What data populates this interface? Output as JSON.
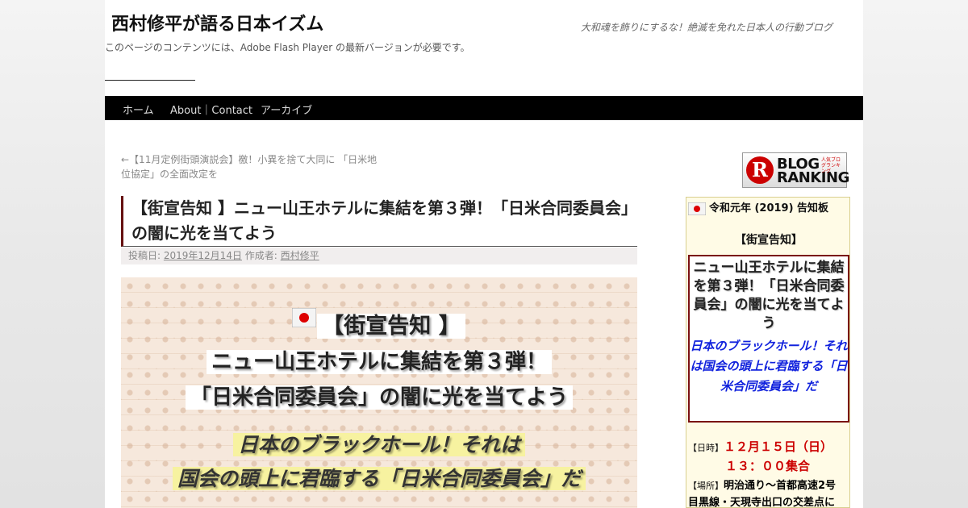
{
  "site": {
    "title": "西村修平が語る日本イズム",
    "tagline": "大和魂を飾りにするな！絶滅を免れた日本人の行動ブログ",
    "flash_notice": "このページのコンテンツには、Adobe Flash Player の最新バージョンが必要です。"
  },
  "nav": {
    "items": [
      "ホーム",
      "About｜Contact",
      "アーカイブ"
    ]
  },
  "prev_post": {
    "line1": "←【11月定例街頭演説会】檄！小異を捨て大同に 「日米地",
    "line2": "位協定」の全面改定を"
  },
  "post": {
    "title": "【街宣告知 】ニュー山王ホテルに集結を第３弾！「日米合同委員会」の闇に光を当てよう",
    "meta_posted_label": "投稿日:",
    "meta_date": "2019年12月14日",
    "meta_author_label": "作成者:",
    "meta_author": "西村修平"
  },
  "banner": {
    "line1": "【街宣告知 】",
    "line2": "ニュー山王ホテルに集結を第３弾！",
    "line3": "「日米合同委員会」の闇に光を当てよう",
    "line4": "日本のブラックホール！それは",
    "line5": "国会の頭上に君臨する「日米合同委員会」だ"
  },
  "ranking_badge": {
    "letter": "R",
    "line1": "BLOG",
    "line2": "RANKING",
    "small": "人気ブログランキング"
  },
  "sidebar": {
    "heading": "令和元年 (2019) 告知板",
    "subheading": "【街宣告知】",
    "box_title": "ニュー山王ホテルに集結を第３弾！「日米合同委員会」の闇に光を当てよう",
    "box_blue": "日本のブラックホール！それは国会の頭上に君臨する「日米合同委員会」だ",
    "date_label": "【日時】",
    "date_value": "１２月１５日（日）",
    "time_value": "１３：００集合",
    "place_label": "【場所】",
    "place_line1": "明治通り～首都高速2号",
    "place_line2": "目黒線・天現寺出口の交差点に"
  },
  "colors": {
    "nav_bg": "#000000",
    "title_accent": "#661111",
    "sidebar_border": "#7a1010",
    "sidebar_blue": "#1122dd",
    "date_red": "#cc0000"
  }
}
